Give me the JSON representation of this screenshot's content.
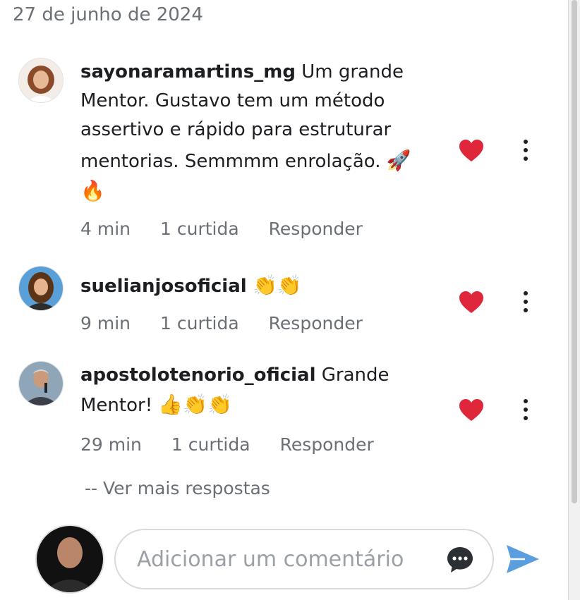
{
  "date": "27 de junho de 2024",
  "comments": [
    {
      "username": "sayonaramartins_mg",
      "text_line1": " Um grande",
      "text_line2": "Mentor. Gustavo tem um método",
      "text_line3": "assertivo e rápido para estruturar",
      "text_line4": "mentorias. Semmmm enrolação. ",
      "emoji_a": "🚀",
      "emoji_b": "🔥",
      "time": "4 min",
      "likes": "1 curtida",
      "reply": "Responder"
    },
    {
      "username": "suelianjosoficial",
      "emoji_a": "👏👏",
      "time": "9 min",
      "likes": "1 curtida",
      "reply": "Responder"
    },
    {
      "username": "apostolotenorio_oficial",
      "text_line1": " Grande",
      "text_line2": "Mentor! ",
      "emoji_a": "👍👏👏",
      "time": "29 min",
      "likes": "1 curtida",
      "reply": "Responder"
    }
  ],
  "more_replies": "-- Ver mais respostas",
  "composer": {
    "placeholder": "Adicionar um comentário"
  },
  "colors": {
    "heart": "#e0263a",
    "send": "#5a9ee0",
    "muted": "#6b6f76"
  },
  "icons": [
    "heart-icon",
    "more-vertical-icon",
    "chat-bubble-icon",
    "send-icon"
  ]
}
